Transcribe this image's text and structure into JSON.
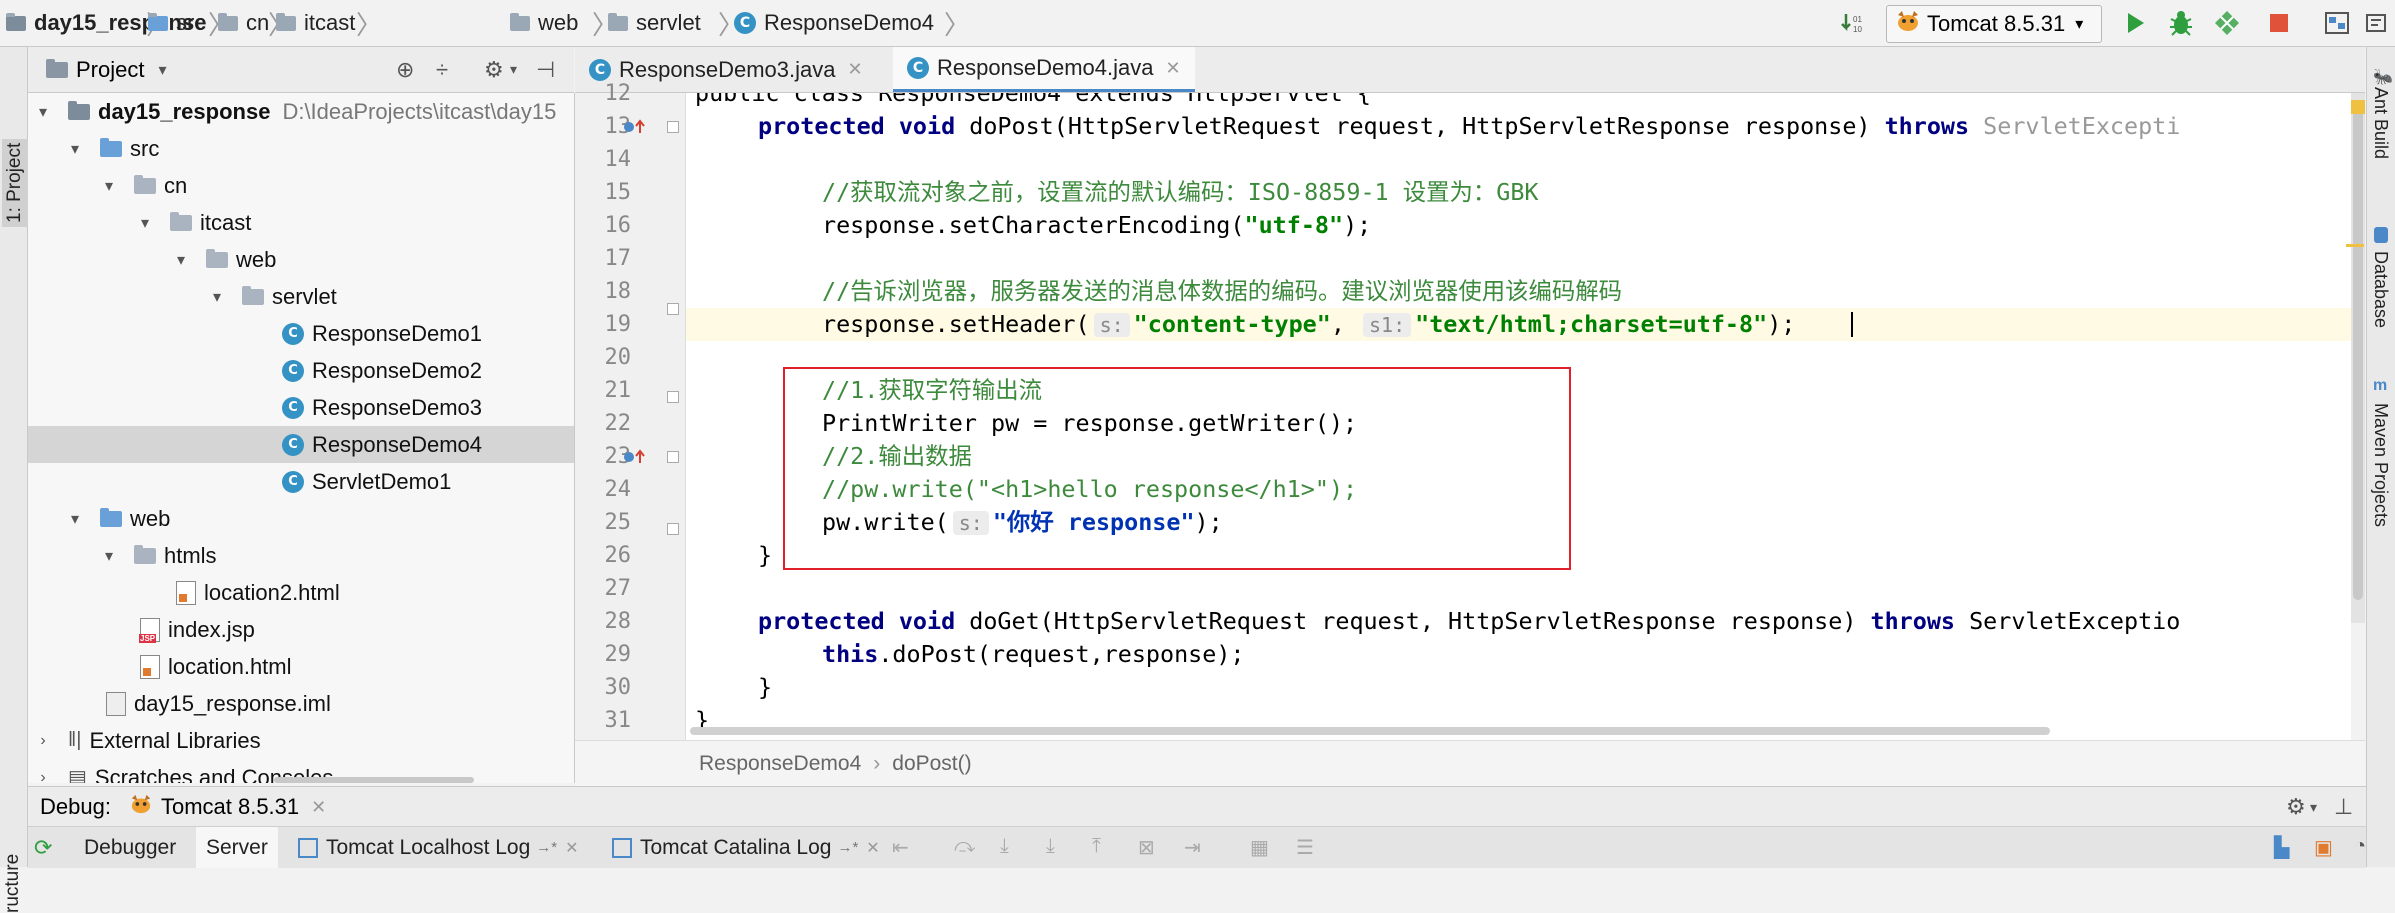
{
  "breadcrumb": [
    "day15_response",
    "src",
    "cn",
    "itcast",
    "web",
    "servlet",
    "ResponseDemo4"
  ],
  "run_config": "Tomcat 8.5.31",
  "left_strip": {
    "project": "1: Project",
    "structure": "ructure"
  },
  "project_panel": {
    "title": "Project",
    "tree": [
      {
        "label": "day15_response",
        "detail": "D:\\IdeaProjects\\itcast\\day15",
        "type": "module"
      },
      {
        "label": "src",
        "type": "src"
      },
      {
        "label": "cn",
        "type": "pkg"
      },
      {
        "label": "itcast",
        "type": "pkg"
      },
      {
        "label": "web",
        "type": "pkg"
      },
      {
        "label": "servlet",
        "type": "pkg"
      },
      {
        "label": "ResponseDemo1",
        "type": "class"
      },
      {
        "label": "ResponseDemo2",
        "type": "class"
      },
      {
        "label": "ResponseDemo3",
        "type": "class"
      },
      {
        "label": "ResponseDemo4",
        "type": "class"
      },
      {
        "label": "ServletDemo1",
        "type": "class"
      },
      {
        "label": "web",
        "type": "folder"
      },
      {
        "label": "htmls",
        "type": "folder"
      },
      {
        "label": "location2.html",
        "type": "html"
      },
      {
        "label": "index.jsp",
        "type": "jsp"
      },
      {
        "label": "location.html",
        "type": "html"
      },
      {
        "label": "day15_response.iml",
        "type": "iml"
      },
      {
        "label": "External Libraries",
        "type": "lib"
      },
      {
        "label": "Scratches and Consoles",
        "type": "scratch"
      }
    ]
  },
  "editor_tabs": [
    {
      "label": "ResponseDemo3.java",
      "active": false
    },
    {
      "label": "ResponseDemo4.java",
      "active": true
    }
  ],
  "code": {
    "line_numbers": [
      "12",
      "13",
      "14",
      "15",
      "16",
      "17",
      "18",
      "19",
      "20",
      "21",
      "22",
      "23",
      "24",
      "25",
      "26",
      "27",
      "28",
      "29",
      "30",
      "31"
    ],
    "l12": "public class ResponseDemo4 extends HttpServlet {",
    "l13": {
      "kw": "protected void",
      "sig": " doPost(HttpServletRequest request, HttpServletResponse response) ",
      "throws": "throws",
      "exc": " ServletExcepti"
    },
    "l15": "//获取流对象之前，设置流的默认编码：ISO-8859-1 设置为：GBK",
    "l16": {
      "pre": "response.setCharacterEncoding(",
      "str": "\"utf-8\"",
      "post": ");"
    },
    "l18": "//告诉浏览器，服务器发送的消息体数据的编码。建议浏览器使用该编码解码",
    "l19": {
      "pre": "response.setHeader(",
      "hint1": "s:",
      "str1": "\"content-type\"",
      "mid": ", ",
      "hint2": "s1:",
      "str2": "\"text/html;charset=utf-8\"",
      "post": ");"
    },
    "l21": "//1.获取字符输出流",
    "l22": "PrintWriter pw = response.getWriter();",
    "l23": "//2.输出数据",
    "l24": "//pw.write(\"<h1>hello response</h1>\");",
    "l25": {
      "pre": "pw.write(",
      "hint": "s:",
      "str": "\"你好 response\"",
      "post": ");"
    },
    "l26": "}",
    "l28": {
      "kw": "protected void",
      "sig": " doGet(HttpServletRequest request, HttpServletResponse response) ",
      "throws": "throws",
      "exc": " ServletExceptio"
    },
    "l29": {
      "kw": "this",
      "rest": ".doPost(request,response);"
    },
    "l30": "}",
    "l31": "}"
  },
  "editor_breadcrumb": [
    "ResponseDemo4",
    "doPost()"
  ],
  "right_strip": [
    "Ant Build",
    "Database",
    "Maven Projects"
  ],
  "debug": {
    "label": "Debug:",
    "session": "Tomcat 8.5.31",
    "tabs": [
      "Debugger",
      "Server",
      "Tomcat Localhost Log",
      "Tomcat Catalina Log"
    ]
  },
  "colors": {
    "keyword": "#000080",
    "string": "#008000",
    "comment": "#3d8a3d",
    "highlight_box": "#e0202a"
  }
}
